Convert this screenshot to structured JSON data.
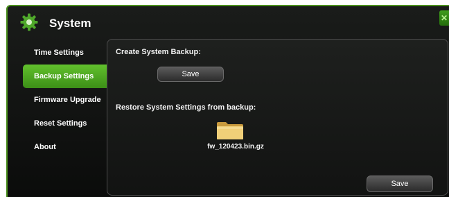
{
  "header": {
    "title": "System",
    "close_label": "✕",
    "accent": "#4a8f1c"
  },
  "sidebar": {
    "items": [
      {
        "label": "Time Settings",
        "active": false
      },
      {
        "label": "Backup Settings",
        "active": true
      },
      {
        "label": "Firmware Upgrade",
        "active": false
      },
      {
        "label": "Reset Settings",
        "active": false
      },
      {
        "label": "About",
        "active": false
      }
    ]
  },
  "main": {
    "backup": {
      "label": "Create System Backup:",
      "button": "Save"
    },
    "restore": {
      "label": "Restore System Settings from backup:",
      "file_name": "fw_120423.bin.gz",
      "icon": "folder-icon"
    },
    "footer_button": "Save"
  }
}
